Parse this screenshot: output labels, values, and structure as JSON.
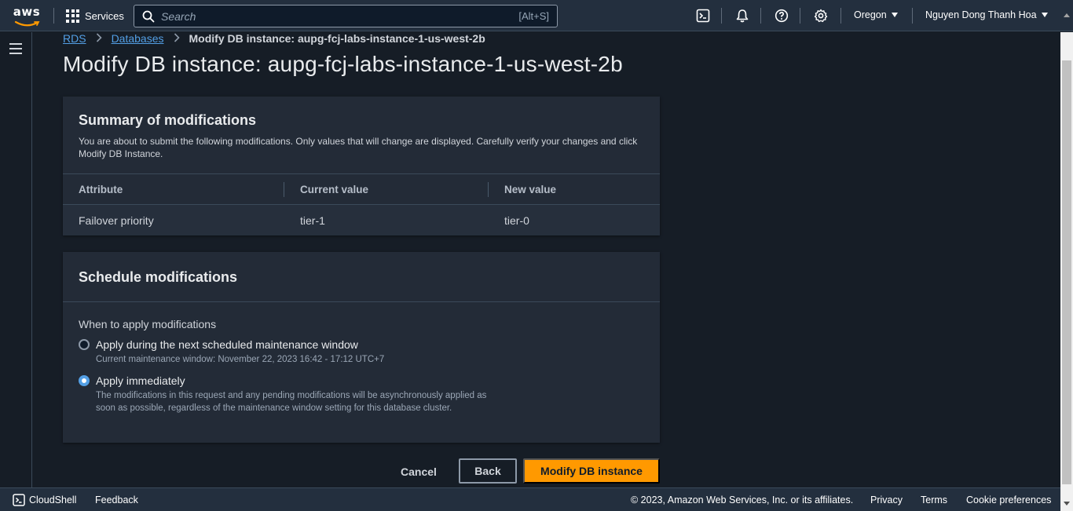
{
  "topnav": {
    "logo_text": "aws",
    "services_label": "Services",
    "search_placeholder": "Search",
    "search_shortcut": "[Alt+S]",
    "region": "Oregon",
    "user": "Nguyen Dong Thanh Hoa"
  },
  "breadcrumb": {
    "items": [
      "RDS",
      "Databases"
    ],
    "current": "Modify DB instance: aupg-fcj-labs-instance-1-us-west-2b"
  },
  "page_title": "Modify DB instance: aupg-fcj-labs-instance-1-us-west-2b",
  "summary": {
    "title": "Summary of modifications",
    "description": "You are about to submit the following modifications. Only values that will change are displayed. Carefully verify your changes and click Modify DB Instance.",
    "columns": [
      "Attribute",
      "Current value",
      "New value"
    ],
    "rows": [
      [
        "Failover priority",
        "tier-1",
        "tier-0"
      ]
    ]
  },
  "schedule": {
    "title": "Schedule modifications",
    "field_label": "When to apply modifications",
    "options": [
      {
        "label": "Apply during the next scheduled maintenance window",
        "description": "Current maintenance window: November 22, 2023 16:42 - 17:12 UTC+7",
        "selected": false
      },
      {
        "label": "Apply immediately",
        "description": "The modifications in this request and any pending modifications will be asynchronously applied as soon as possible, regardless of the maintenance window setting for this database cluster.",
        "selected": true
      }
    ]
  },
  "buttons": {
    "cancel": "Cancel",
    "back": "Back",
    "modify": "Modify DB instance"
  },
  "footer": {
    "cloudshell": "CloudShell",
    "feedback": "Feedback",
    "copyright": "© 2023, Amazon Web Services, Inc. or its affiliates.",
    "privacy": "Privacy",
    "terms": "Terms",
    "cookie": "Cookie preferences"
  },
  "colors": {
    "accent_link": "#539fe5",
    "primary_button": "#ff9900",
    "nav_bg": "#232f3e",
    "page_bg": "#161d26"
  },
  "icons": [
    "aws-logo",
    "services-grid-icon",
    "search-icon",
    "cloudshell-icon",
    "notifications-bell-icon",
    "help-icon",
    "settings-gear-icon",
    "menu-hamburger-icon"
  ]
}
